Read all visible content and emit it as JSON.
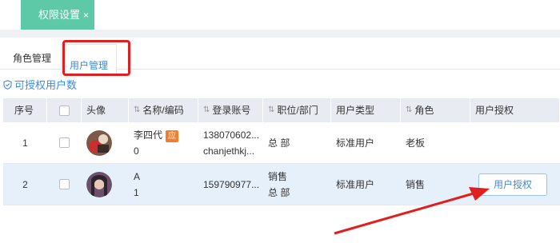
{
  "page_tab": {
    "label": "权限设置",
    "close": "×"
  },
  "subtabs": {
    "roles": "角色管理",
    "users": "用户管理"
  },
  "auth_link": {
    "label": "可授权用户数"
  },
  "table": {
    "headers": {
      "index": "序号",
      "avatar": "头像",
      "name": "名称/编码",
      "login": "登录账号",
      "position": "职位/部门",
      "user_type": "用户类型",
      "role": "角色",
      "grant": "用户授权"
    },
    "rows": [
      {
        "index": "1",
        "name": "李四代",
        "badge": "应",
        "code": "0",
        "login_line1": "138070602...",
        "login_line2": "chanjethkj...",
        "position": "",
        "department": "总 部",
        "user_type": "标准用户",
        "role": "老板",
        "grant": ""
      },
      {
        "index": "2",
        "name": "A",
        "code": "1",
        "login_line1": "159790977...",
        "position": "销售",
        "department": "总 部",
        "user_type": "标准用户",
        "role": "销售",
        "grant": "用户授权"
      }
    ]
  },
  "colors": {
    "accent": "#5ec9a7",
    "link": "#3b8be0",
    "highlight": "#e02020",
    "selected_row": "#e6f0fb"
  }
}
